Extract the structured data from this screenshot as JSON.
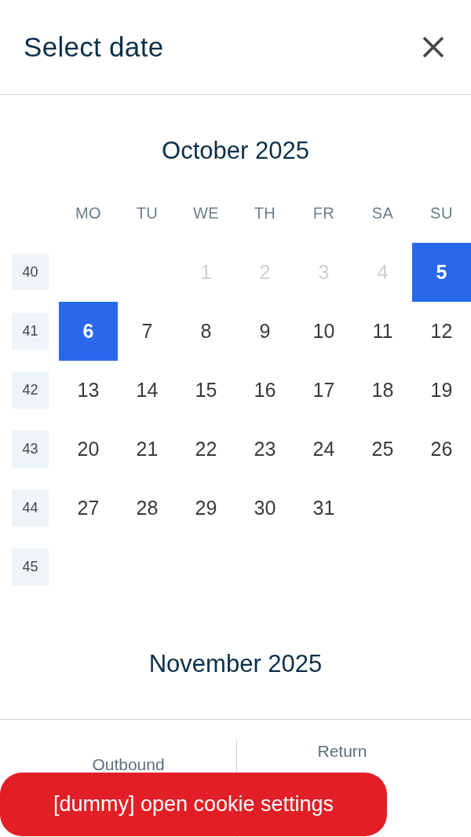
{
  "header": {
    "title": "Select date"
  },
  "months": [
    {
      "title": "October 2025",
      "weekdays": [
        "MO",
        "TU",
        "WE",
        "TH",
        "FR",
        "SA",
        "SU"
      ],
      "weeks": [
        {
          "number": "40",
          "days": [
            {
              "kind": "blank"
            },
            {
              "kind": "blank"
            },
            {
              "kind": "day",
              "label": "1",
              "selected": false,
              "disabled": true
            },
            {
              "kind": "day",
              "label": "2",
              "selected": false,
              "disabled": true
            },
            {
              "kind": "day",
              "label": "3",
              "selected": false,
              "disabled": true
            },
            {
              "kind": "day",
              "label": "4",
              "selected": false,
              "disabled": true
            },
            {
              "kind": "day",
              "label": "5",
              "selected": true,
              "disabled": false
            }
          ]
        },
        {
          "number": "41",
          "days": [
            {
              "kind": "day",
              "label": "6",
              "selected": true,
              "disabled": false
            },
            {
              "kind": "day",
              "label": "7",
              "selected": false,
              "disabled": false
            },
            {
              "kind": "day",
              "label": "8",
              "selected": false,
              "disabled": false
            },
            {
              "kind": "day",
              "label": "9",
              "selected": false,
              "disabled": false
            },
            {
              "kind": "day",
              "label": "10",
              "selected": false,
              "disabled": false
            },
            {
              "kind": "day",
              "label": "11",
              "selected": false,
              "disabled": false
            },
            {
              "kind": "day",
              "label": "12",
              "selected": false,
              "disabled": false
            }
          ]
        },
        {
          "number": "42",
          "days": [
            {
              "kind": "day",
              "label": "13",
              "selected": false,
              "disabled": false
            },
            {
              "kind": "day",
              "label": "14",
              "selected": false,
              "disabled": false
            },
            {
              "kind": "day",
              "label": "15",
              "selected": false,
              "disabled": false
            },
            {
              "kind": "day",
              "label": "16",
              "selected": false,
              "disabled": false
            },
            {
              "kind": "day",
              "label": "17",
              "selected": false,
              "disabled": false
            },
            {
              "kind": "day",
              "label": "18",
              "selected": false,
              "disabled": false
            },
            {
              "kind": "day",
              "label": "19",
              "selected": false,
              "disabled": false
            }
          ]
        },
        {
          "number": "43",
          "days": [
            {
              "kind": "day",
              "label": "20",
              "selected": false,
              "disabled": false
            },
            {
              "kind": "day",
              "label": "21",
              "selected": false,
              "disabled": false
            },
            {
              "kind": "day",
              "label": "22",
              "selected": false,
              "disabled": false
            },
            {
              "kind": "day",
              "label": "23",
              "selected": false,
              "disabled": false
            },
            {
              "kind": "day",
              "label": "24",
              "selected": false,
              "disabled": false
            },
            {
              "kind": "day",
              "label": "25",
              "selected": false,
              "disabled": false
            },
            {
              "kind": "day",
              "label": "26",
              "selected": false,
              "disabled": false
            }
          ]
        },
        {
          "number": "44",
          "days": [
            {
              "kind": "day",
              "label": "27",
              "selected": false,
              "disabled": false
            },
            {
              "kind": "day",
              "label": "28",
              "selected": false,
              "disabled": false
            },
            {
              "kind": "day",
              "label": "29",
              "selected": false,
              "disabled": false
            },
            {
              "kind": "day",
              "label": "30",
              "selected": false,
              "disabled": false
            },
            {
              "kind": "day",
              "label": "31",
              "selected": false,
              "disabled": false
            },
            {
              "kind": "blank"
            },
            {
              "kind": "blank"
            }
          ]
        },
        {
          "number": "45"
        }
      ]
    },
    {
      "title": "November 2025"
    }
  ],
  "footer": {
    "outbound": {
      "label": "Outbound"
    },
    "return": {
      "label": "Return"
    }
  },
  "cookie_button": {
    "label": "[dummy] open cookie settings"
  }
}
